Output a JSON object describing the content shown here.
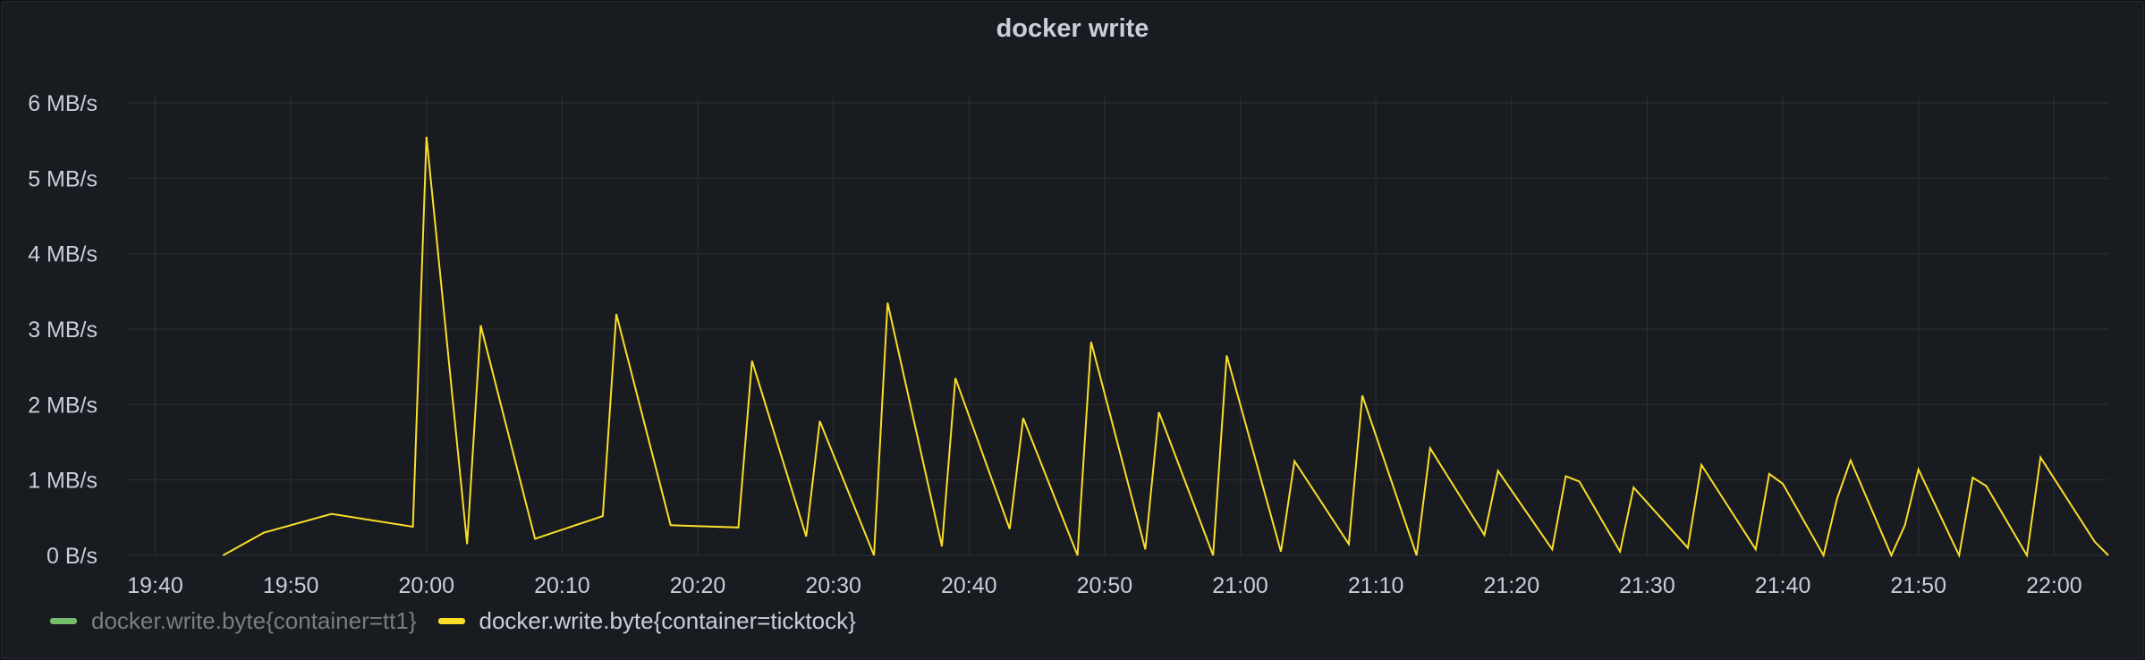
{
  "panel": {
    "title": "docker write"
  },
  "chart_data": {
    "type": "line",
    "title": "docker write",
    "y_unit": "MB/s",
    "ylim": [
      0,
      6
    ],
    "y_ticks": [
      {
        "value": 0,
        "label": "0 B/s"
      },
      {
        "value": 1,
        "label": "1 MB/s"
      },
      {
        "value": 2,
        "label": "2 MB/s"
      },
      {
        "value": 3,
        "label": "3 MB/s"
      },
      {
        "value": 4,
        "label": "4 MB/s"
      },
      {
        "value": 5,
        "label": "5 MB/s"
      },
      {
        "value": 6,
        "label": "6 MB/s"
      }
    ],
    "xlim": [
      "19:37",
      "22:04"
    ],
    "x_ticks": [
      "19:40",
      "19:50",
      "20:00",
      "20:10",
      "20:20",
      "20:30",
      "20:40",
      "20:50",
      "21:00",
      "21:10",
      "21:20",
      "21:30",
      "21:40",
      "21:50",
      "22:00"
    ],
    "grid": true,
    "legend_position": "bottom-left",
    "series": [
      {
        "name": "docker.write.byte{container=tt1}",
        "color": "#73bf69",
        "hidden": true,
        "points": []
      },
      {
        "name": "docker.write.byte{container=ticktock}",
        "color": "#fade2a",
        "hidden": false,
        "points": [
          [
            "19:45",
            0.0
          ],
          [
            "19:48",
            0.3
          ],
          [
            "19:53",
            0.55
          ],
          [
            "19:59",
            0.38
          ],
          [
            "20:00",
            5.55
          ],
          [
            "20:03",
            0.15
          ],
          [
            "20:04",
            3.05
          ],
          [
            "20:08",
            0.22
          ],
          [
            "20:13",
            0.52
          ],
          [
            "20:14",
            3.2
          ],
          [
            "20:18",
            0.4
          ],
          [
            "20:23",
            0.37
          ],
          [
            "20:24",
            2.58
          ],
          [
            "20:28",
            0.25
          ],
          [
            "20:29",
            1.78
          ],
          [
            "20:33",
            0.0
          ],
          [
            "20:34",
            3.35
          ],
          [
            "20:38",
            0.12
          ],
          [
            "20:39",
            2.35
          ],
          [
            "20:43",
            0.35
          ],
          [
            "20:44",
            1.82
          ],
          [
            "20:48",
            0.0
          ],
          [
            "20:49",
            2.83
          ],
          [
            "20:53",
            0.08
          ],
          [
            "20:54",
            1.9
          ],
          [
            "20:58",
            0.0
          ],
          [
            "20:59",
            2.65
          ],
          [
            "21:03",
            0.05
          ],
          [
            "21:04",
            1.25
          ],
          [
            "21:08",
            0.15
          ],
          [
            "21:09",
            2.12
          ],
          [
            "21:13",
            0.0
          ],
          [
            "21:14",
            1.42
          ],
          [
            "21:18",
            0.27
          ],
          [
            "21:19",
            1.12
          ],
          [
            "21:23",
            0.08
          ],
          [
            "21:24",
            1.05
          ],
          [
            "21:25",
            0.98
          ],
          [
            "21:28",
            0.05
          ],
          [
            "21:29",
            0.9
          ],
          [
            "21:33",
            0.1
          ],
          [
            "21:34",
            1.2
          ],
          [
            "21:38",
            0.08
          ],
          [
            "21:39",
            1.08
          ],
          [
            "21:40",
            0.95
          ],
          [
            "21:43",
            0.0
          ],
          [
            "21:44",
            0.75
          ],
          [
            "21:45",
            1.26
          ],
          [
            "21:48",
            0.0
          ],
          [
            "21:49",
            0.4
          ],
          [
            "21:50",
            1.14
          ],
          [
            "21:53",
            0.0
          ],
          [
            "21:54",
            1.03
          ],
          [
            "21:55",
            0.92
          ],
          [
            "21:58",
            0.0
          ],
          [
            "21:59",
            1.3
          ],
          [
            "22:03",
            0.18
          ],
          [
            "22:04",
            0.0
          ]
        ]
      }
    ]
  }
}
